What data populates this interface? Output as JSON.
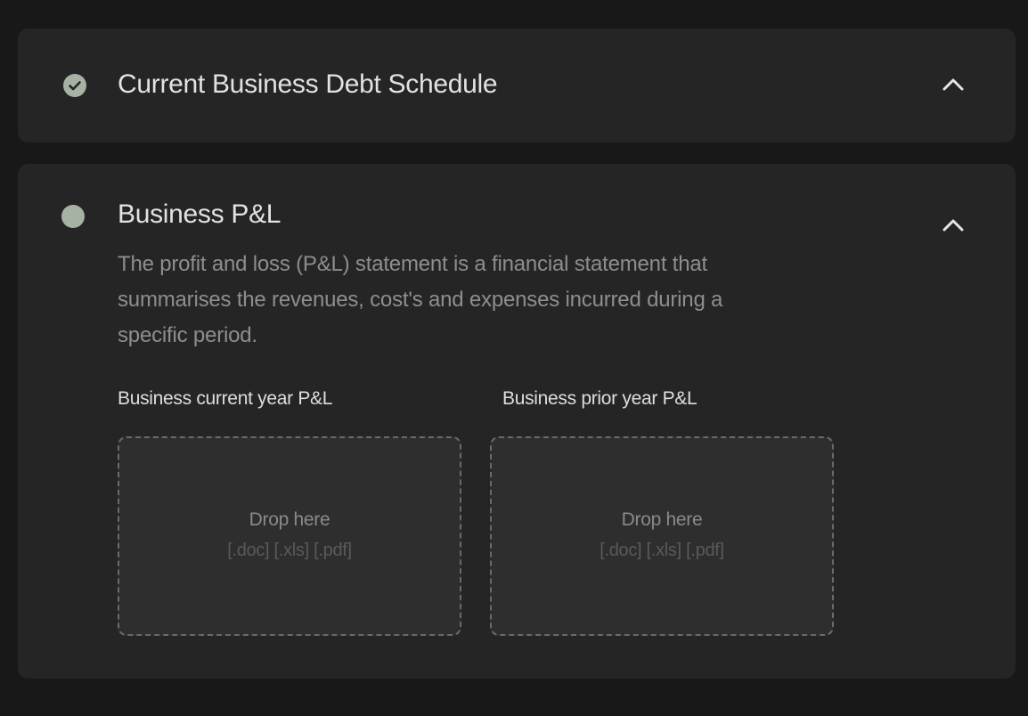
{
  "sections": {
    "debt_schedule": {
      "title": "Current Business Debt Schedule",
      "status_icon": "check-circle-icon",
      "toggle_icon": "chevron-up-icon"
    },
    "business_pl": {
      "title": "Business P&L",
      "status_icon": "dot-circle-icon",
      "toggle_icon": "chevron-up-icon",
      "description": "The profit and loss (P&L)  statement is a financial statement that summarises the revenues, cost's and expenses incurred during a specific period.",
      "uploads": [
        {
          "label": "Business current year P&L",
          "drop_text": "Drop here",
          "formats": "[.doc] [.xls] [.pdf]"
        },
        {
          "label": "Business prior year P&L",
          "drop_text": "Drop here",
          "formats": "[.doc] [.xls] [.pdf]"
        }
      ]
    }
  },
  "colors": {
    "background": "#181818",
    "card": "#252525",
    "status_green": "#a6b3a3",
    "dropzone": "#2e2e2e"
  }
}
